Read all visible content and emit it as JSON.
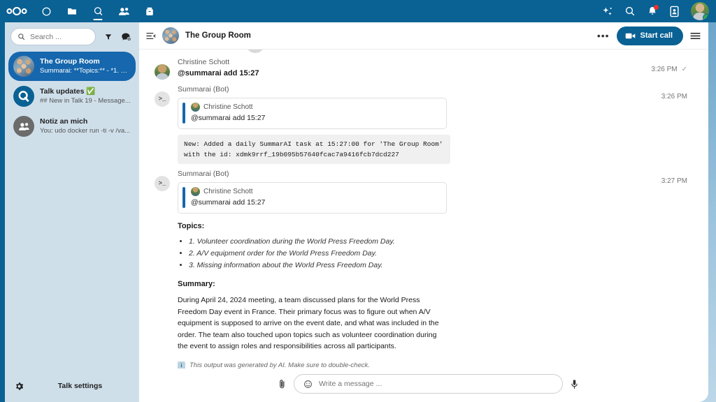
{
  "topbar": {
    "logo_name": "nextcloud-logo",
    "nav": [
      {
        "name": "dashboard",
        "icon": "circle-icon",
        "active": false
      },
      {
        "name": "files",
        "icon": "folder-icon",
        "active": false
      },
      {
        "name": "talk",
        "icon": "talk-icon",
        "active": true
      },
      {
        "name": "contacts",
        "icon": "contacts-icon",
        "active": false
      },
      {
        "name": "archive",
        "icon": "archive-icon",
        "active": false
      }
    ],
    "right": [
      {
        "name": "assistant",
        "icon": "sparkle-icon"
      },
      {
        "name": "search",
        "icon": "search-icon"
      },
      {
        "name": "notifications",
        "icon": "bell-icon",
        "badge": true
      },
      {
        "name": "contacts-menu",
        "icon": "contacts-card-icon"
      },
      {
        "name": "user",
        "icon": "avatar",
        "status": "online"
      }
    ],
    "accent_color": "#0a6193",
    "badge_color": "#e9322d",
    "status_color": "#2fa84f"
  },
  "sidebar": {
    "search": {
      "placeholder": "Search ...",
      "value": ""
    },
    "filter_label": "Filter conversations",
    "new_conversation_label": "New conversation",
    "conversations": [
      {
        "name": "The Group Room",
        "preview": "Summarai: **Topics:** - *1. D...",
        "avatar": "group-photo",
        "selected": true
      },
      {
        "name": "Talk updates ✅",
        "preview": "## New in Talk 19 - Message...",
        "avatar": "talk-logo",
        "selected": false
      },
      {
        "name": "Notiz an mich",
        "preview": "You: udo docker run -ti -v /va...",
        "avatar": "group-generic",
        "selected": false
      }
    ],
    "settings_label": "Talk settings",
    "bg_color": "#cfdfea",
    "selected_color": "#1667ad"
  },
  "conversation": {
    "title": "The Group Room",
    "collapse_label": "Collapse sidebar",
    "more_label": "Conversation actions",
    "start_call_label": "Start call",
    "open_sidebar_label": "Open conversation info"
  },
  "messages": [
    {
      "author": "Christine Schott",
      "avatar": "person-photo",
      "text": "@summarai add 15:27",
      "time": "3:26 PM",
      "read_state": "✓"
    },
    {
      "author": "Summarai (Bot)",
      "avatar": "bot-terminal",
      "time": "3:26 PM",
      "read_state": "",
      "quote": {
        "author": "Christine Schott",
        "text": "@summarai add 15:27"
      },
      "code": "New: Added a daily SummarAI task at 15:27:00 for 'The Group Room'\nwith the id: xdmk9rrf_19b095b57640fcac7a9416fcb7dcd227"
    },
    {
      "author": "Summarai (Bot)",
      "avatar": "bot-terminal",
      "time": "3:27 PM",
      "read_state": "",
      "quote": {
        "author": "Christine Schott",
        "text": "@summarai add 15:27"
      },
      "topics_heading": "Topics:",
      "topics": [
        "1. Volunteer coordination during the World Press Freedom Day.",
        "2. A/V equipment order for the World Press Freedom Day.",
        "3. Missing information about the World Press Freedom Day."
      ],
      "summary_heading": "Summary:",
      "summary": "During April 24, 2024 meeting, a team discussed plans for the World Press Freedom Day event in France. Their primary focus was to figure out when A/V equipment is supposed to arrive on the event date, and what was included in the order. The team also touched upon topics such as volunteer coordination during the event to assign roles and responsibilities across all participants.",
      "ai_note_icon": "info-icon",
      "ai_note": "This output was generated by AI. Make sure to double-check."
    }
  ],
  "composer": {
    "attach_label": "Attach file",
    "emoji_label": "Add emoji",
    "placeholder": "Write a message ...",
    "value": "",
    "audio_label": "Record voice message"
  }
}
